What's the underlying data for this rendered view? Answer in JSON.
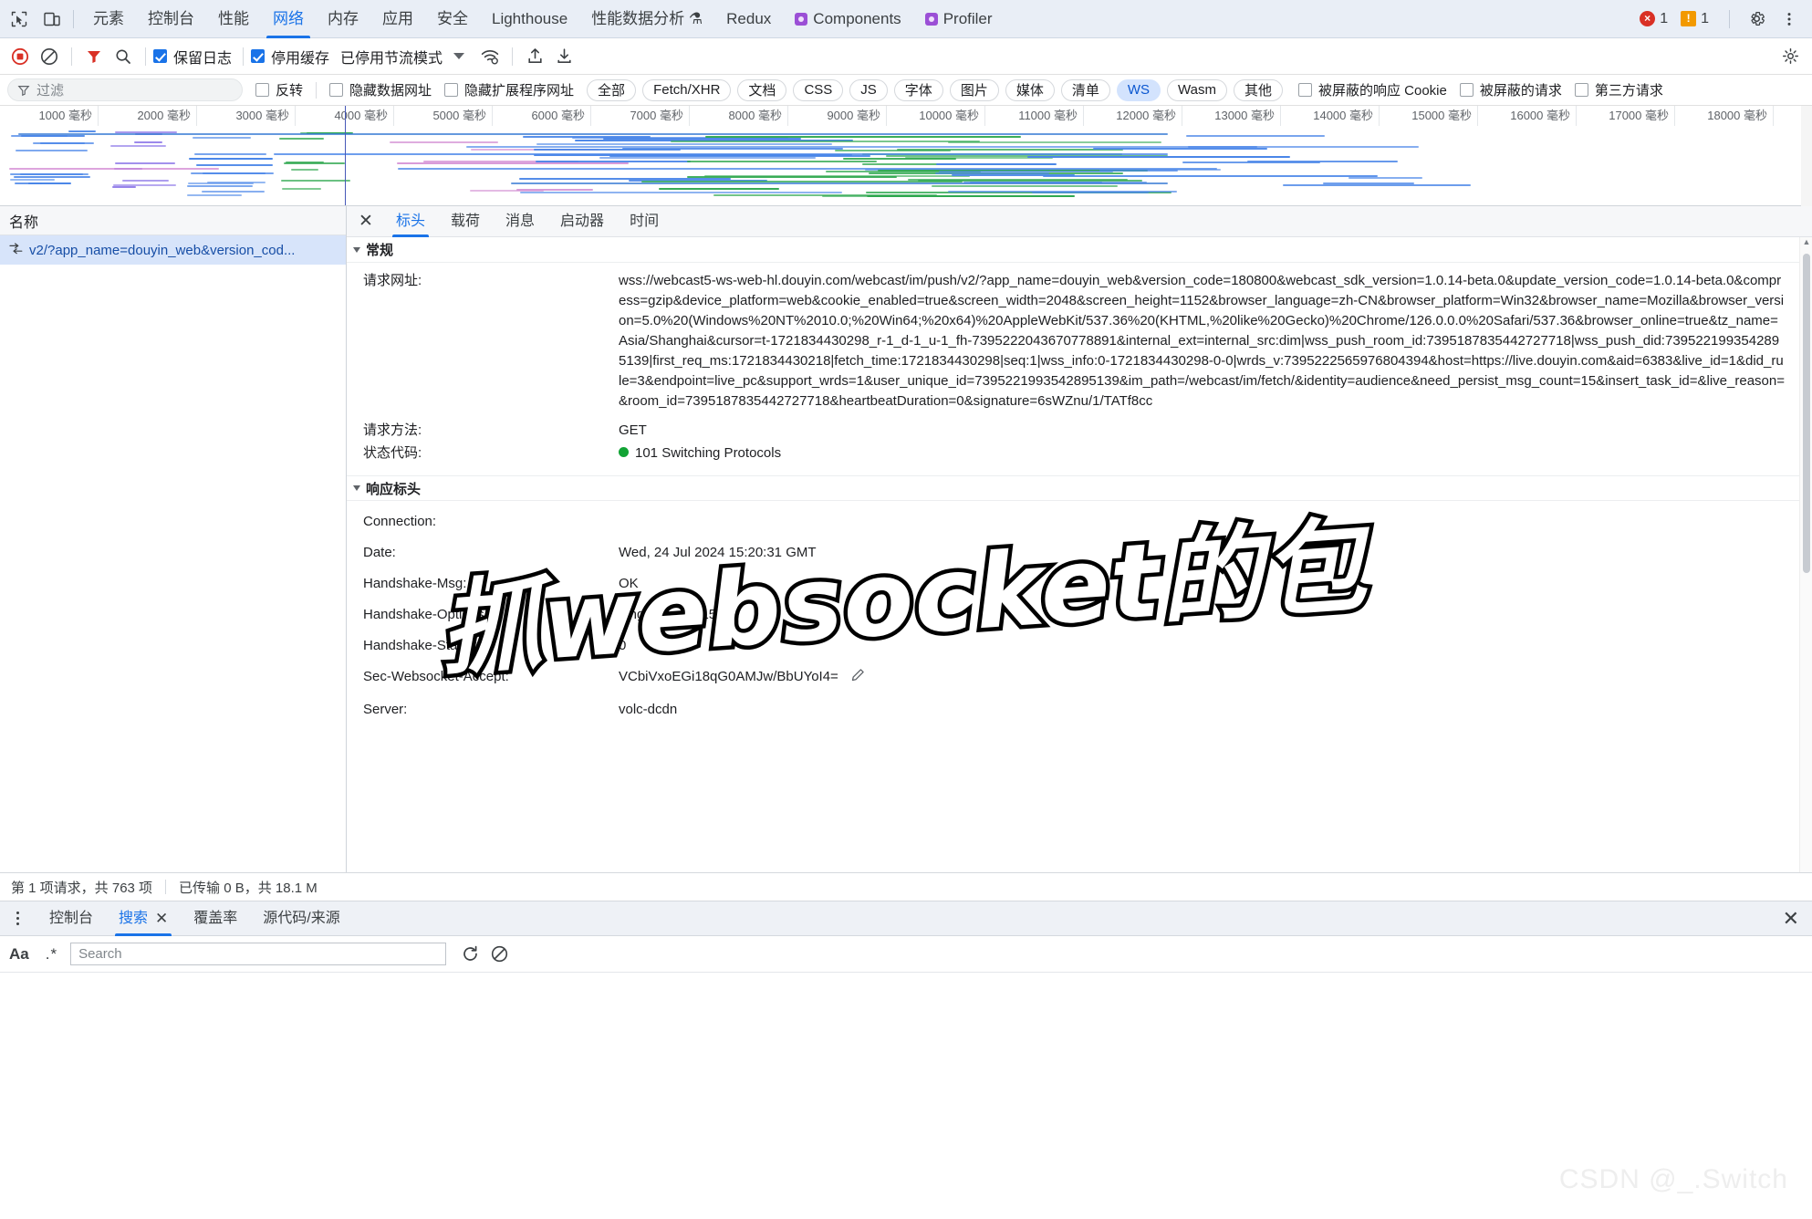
{
  "topbar": {
    "icons": [
      {
        "name": "inspect-element-icon",
        "glyph": "⬚"
      },
      {
        "name": "device-toolbar-icon",
        "glyph": "▭"
      }
    ],
    "tabs": [
      {
        "label": "元素",
        "active": false,
        "ext": false
      },
      {
        "label": "控制台",
        "active": false,
        "ext": false
      },
      {
        "label": "性能",
        "active": false,
        "ext": false
      },
      {
        "label": "网络",
        "active": true,
        "ext": false
      },
      {
        "label": "内存",
        "active": false,
        "ext": false
      },
      {
        "label": "应用",
        "active": false,
        "ext": false
      },
      {
        "label": "安全",
        "active": false,
        "ext": false
      },
      {
        "label": "Lighthouse",
        "active": false,
        "ext": false
      },
      {
        "label": "性能数据分析 ⚗",
        "active": false,
        "ext": false
      },
      {
        "label": "Redux",
        "active": false,
        "ext": false
      },
      {
        "label": "Components",
        "active": false,
        "ext": true
      },
      {
        "label": "Profiler",
        "active": false,
        "ext": true
      }
    ],
    "error_count": "1",
    "warning_count": "1",
    "settings_label": "设置",
    "more_label": "更多选项"
  },
  "net_toolbar": {
    "record_label": "停止记录网络日志",
    "clear_label": "清除",
    "filter_label": "过滤器",
    "search_label": "搜索",
    "preserve_log": {
      "label": "保留日志",
      "checked": true
    },
    "disable_cache": {
      "label": "停用缓存",
      "checked": true
    },
    "throttle": {
      "label": "已停用节流模式"
    },
    "wifi_label": "网络状况",
    "import_label": "导入 HAR 文件",
    "export_label": "导出 HAR 文件",
    "settings_label": "网络设置"
  },
  "filter_bar": {
    "placeholder": "过滤",
    "invert": {
      "label": "反转",
      "checked": false
    },
    "hide_data_urls": {
      "label": "隐藏数据网址",
      "checked": false
    },
    "hide_ext_urls": {
      "label": "隐藏扩展程序网址",
      "checked": false
    },
    "types": [
      {
        "label": "全部",
        "selected": false
      },
      {
        "label": "Fetch/XHR",
        "selected": false
      },
      {
        "label": "文档",
        "selected": false
      },
      {
        "label": "CSS",
        "selected": false
      },
      {
        "label": "JS",
        "selected": false
      },
      {
        "label": "字体",
        "selected": false
      },
      {
        "label": "图片",
        "selected": false
      },
      {
        "label": "媒体",
        "selected": false
      },
      {
        "label": "清单",
        "selected": false
      },
      {
        "label": "WS",
        "selected": true
      },
      {
        "label": "Wasm",
        "selected": false
      },
      {
        "label": "其他",
        "selected": false
      }
    ],
    "blocked_cookies": {
      "label": "被屏蔽的响应 Cookie",
      "checked": false
    },
    "blocked_requests": {
      "label": "被屏蔽的请求",
      "checked": false
    },
    "third_party": {
      "label": "第三方请求",
      "checked": false
    }
  },
  "overview": {
    "ticks": [
      "1000 毫秒",
      "2000 毫秒",
      "3000 毫秒",
      "4000 毫秒",
      "5000 毫秒",
      "6000 毫秒",
      "7000 毫秒",
      "8000 毫秒",
      "9000 毫秒",
      "10000 毫秒",
      "11000 毫秒",
      "12000 毫秒",
      "13000 毫秒",
      "14000 毫秒",
      "15000 毫秒",
      "16000 毫秒",
      "17000 毫秒",
      "18000 毫秒"
    ]
  },
  "request_list": {
    "column_name": "名称",
    "rows": [
      {
        "name": "v2/?app_name=douyin_web&version_cod...",
        "selected": true,
        "icon": "websocket-icon"
      }
    ]
  },
  "detail": {
    "tabs": [
      {
        "label": "标头",
        "active": true
      },
      {
        "label": "载荷",
        "active": false
      },
      {
        "label": "消息",
        "active": false
      },
      {
        "label": "启动器",
        "active": false
      },
      {
        "label": "时间",
        "active": false
      }
    ],
    "general": {
      "title": "常规",
      "request_url_label": "请求网址:",
      "request_url_value": "wss://webcast5-ws-web-hl.douyin.com/webcast/im/push/v2/?app_name=douyin_web&version_code=180800&webcast_sdk_version=1.0.14-beta.0&update_version_code=1.0.14-beta.0&compress=gzip&device_platform=web&cookie_enabled=true&screen_width=2048&screen_height=1152&browser_language=zh-CN&browser_platform=Win32&browser_name=Mozilla&browser_version=5.0%20(Windows%20NT%2010.0;%20Win64;%20x64)%20AppleWebKit/537.36%20(KHTML,%20like%20Gecko)%20Chrome/126.0.0.0%20Safari/537.36&browser_online=true&tz_name=Asia/Shanghai&cursor=t-1721834430298_r-1_d-1_u-1_fh-7395222043670778891&internal_ext=internal_src:dim|wss_push_room_id:7395187835442727718|wss_push_did:7395221993542895139|first_req_ms:1721834430218|fetch_time:1721834430298|seq:1|wss_info:0-1721834430298-0-0|wrds_v:7395222565976804394&host=https://live.douyin.com&aid=6383&live_id=1&did_rule=3&endpoint=live_pc&support_wrds=1&user_unique_id=7395221993542895139&im_path=/webcast/im/fetch/&identity=audience&need_persist_msg_count=15&insert_task_id=&live_reason=&room_id=7395187835442727718&heartbeatDuration=0&signature=6sWZnu/1/TATf8cc",
      "request_method_label": "请求方法:",
      "request_method_value": "GET",
      "status_code_label": "状态代码:",
      "status_code_value": "101 Switching Protocols",
      "status_color": "#12a335"
    },
    "response_headers": {
      "title": "响应标头",
      "rows": [
        {
          "key": "Connection:",
          "value": "",
          "editable": false
        },
        {
          "key": "Date:",
          "value": "Wed, 24 Jul 2024 15:20:31 GMT",
          "editable": false
        },
        {
          "key": "Handshake-Msg:",
          "value": "OK",
          "editable": false
        },
        {
          "key": "Handshake-Options:",
          "value": "ping-interval=15;",
          "editable": false
        },
        {
          "key": "Handshake-Status:",
          "value": "0",
          "editable": false
        },
        {
          "key": "Sec-Websocket-Accept:",
          "value": "VCbiVxoEGi18qG0AMJw/BbUYoI4=",
          "editable": true
        },
        {
          "key": "Server:",
          "value": "volc-dcdn",
          "editable": false
        }
      ]
    }
  },
  "statusbar": {
    "requests": "第 1 项请求，共 763 项",
    "transferred": "已传输 0 B，共 18.1 M"
  },
  "drawer": {
    "tabs": [
      {
        "label": "控制台",
        "active": false,
        "closable": false
      },
      {
        "label": "搜索",
        "active": true,
        "closable": true
      },
      {
        "label": "覆盖率",
        "active": false,
        "closable": false
      },
      {
        "label": "源代码/来源",
        "active": false,
        "closable": false
      }
    ],
    "close_label": "关闭",
    "search": {
      "match_case_label": "Aa",
      "regex_label": ".*",
      "placeholder": "Search",
      "value": "",
      "refresh_label": "刷新",
      "clear_label": "清除"
    }
  },
  "overlay": {
    "text": "抓websocket的包"
  },
  "watermark": {
    "text": "CSDN @_.Switch"
  }
}
